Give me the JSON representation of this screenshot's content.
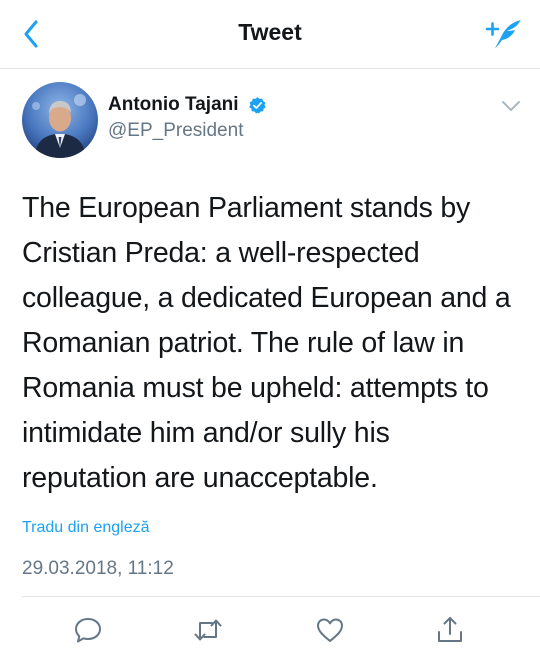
{
  "nav": {
    "title": "Tweet"
  },
  "author": {
    "name": "Antonio Tajani",
    "handle": "@EP_President",
    "verified": true
  },
  "tweet": {
    "text": "The European Parliament stands by Cristian Preda: a well-respected colleague, a dedicated European and a Romanian patriot. The rule of law in Romania must be upheld: attempts to intimidate him and/or sully his reputation are unacceptable.",
    "translate_label": "Tradu din engleză",
    "timestamp": "29.03.2018, 11:12"
  },
  "icons": {
    "back": "chevron-left-icon",
    "compose": "compose-tweet-icon",
    "verified": "verified-badge-icon",
    "caret": "chevron-down-icon",
    "reply": "reply-icon",
    "retweet": "retweet-icon",
    "like": "heart-icon",
    "share": "share-icon"
  },
  "colors": {
    "accent": "#1da1f2",
    "text": "#14171a",
    "secondary": "#657786",
    "divider": "#e1e4e8"
  }
}
